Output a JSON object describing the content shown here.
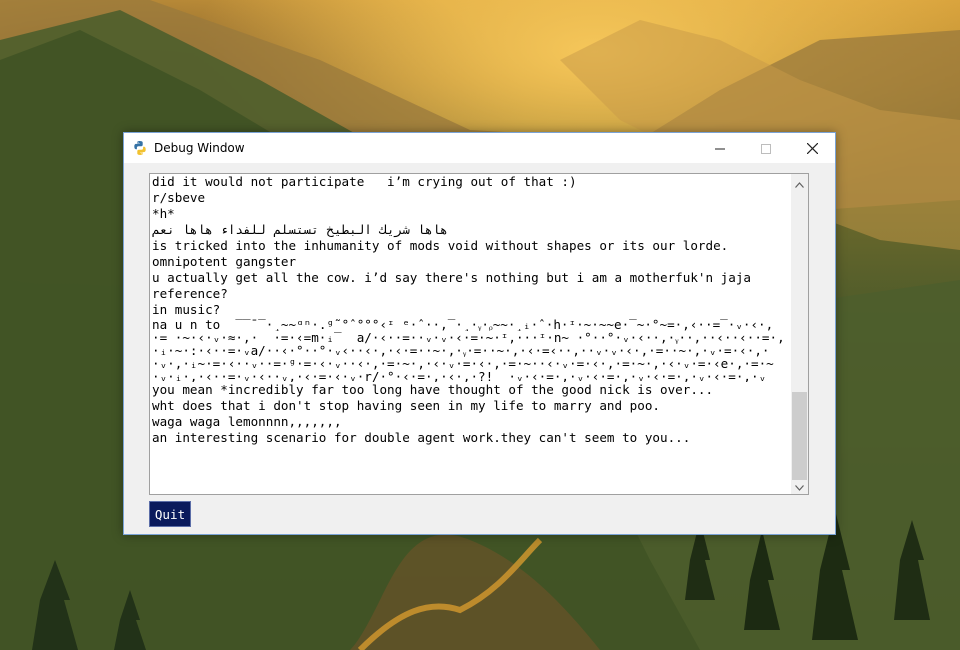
{
  "window": {
    "title": "Debug Window",
    "icon": "python-logo-icon",
    "controls": {
      "minimize": "minimize-icon",
      "maximize": "maximize-icon",
      "close": "close-icon"
    }
  },
  "log": {
    "lines_before": [
      "did it would not participate   i’m crying out of that :)",
      "r/sbeve",
      "*h*",
      "هاها شريك البطيخ تستسلم للفداء هاها نعم",
      "is tricked into the inhumanity of mods void without shapes or its our lorde.",
      "omnipotent gangster",
      "u actually get all the cow. i’d say there's nothing but i am a motherfuk'n jaja",
      "reference?",
      "in music?",
      "na u n to"
    ],
    "garbled_lines": [
      "  ‾‾ˉ‾·¸~~ᵅⁿ·.ᵍ˜°ˆ°°°‹ᶦ_ᵉ·ˆ··‚‾·¸·ᵧ·ᵨ~~·¸ᵢ·ˆ·h·ᶦ·~·~~e·‾~·°~=·,‹··=‾·ᵥ·‹·‚   ·‹·~·‾",
      "·= ·~·‹·ᵥ·≈·‚·  ·=·‹=m·ᵢ‾  a/·‹··=··ᵥ·ᵥ·‹·=·~·ᶦ‚···ᶦ·n~ ·°··°·ᵥ·‹··‚·ᵧ··‚··‹··‹··=·‚",
      "·ᵢ·~·:·‹··=·ᵥa/··‹·°··°·ᵥ‹··‹·‚·‹·=··~·‚·ᵧ·=··~·‚·‹·=‹··‚··ᵥ·ᵥ·‹·‚·=··~·‚·ᵥ·=·‹·‚·",
      "·ᵥ·‚·ᵢ~·=·‹··ᵥ··=·ᵍ·=·‹·ᵥ··‹·‚·=·~·‚·‹·ᵥ·=·‹·‚·=·~··‹·ᵥ·=·‹·‚·=·~·‚·‹·ᵥ·=·‹e·‚·=·~",
      "·ᵥ·ᵢ·‚·‹··=·ᵥ·‹··ᵥ‚·‹·=·‹·ᵥ·r/·°·‹·=·‚·‹·‚·?!  ·ᵥ·‹·=·‚·ᵥ·‹·=·‚·ᵥ·‹·=·‚·ᵥ·‹·=·‚·ᵥ"
    ],
    "lines_after": [
      "you mean *incredibly far too long have thought of the good nick is over...",
      "wht does that i don't stop having seen in my life to marry and poo.",
      "waga waga lemonnnn,,,,,,,",
      "an interesting scenario for double agent work.they can't seem to you..."
    ]
  },
  "scrollbar": {
    "up_icon": "chevron-up-icon",
    "down_icon": "chevron-down-icon"
  },
  "buttons": {
    "quit": "Quit"
  }
}
